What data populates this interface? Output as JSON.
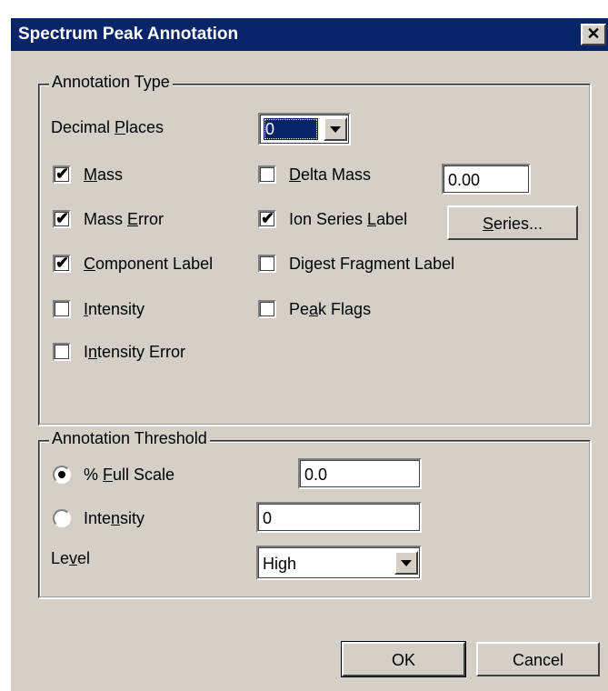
{
  "window": {
    "title": "Spectrum Peak Annotation",
    "close_glyph": "✕"
  },
  "annotation_type": {
    "legend": "Annotation Type",
    "decimal_places": {
      "label_pre": "Decimal ",
      "label_ul": "P",
      "label_post": "laces",
      "value": "0"
    },
    "mass": {
      "label_pre": "",
      "label_ul": "M",
      "label_post": "ass",
      "checked": true
    },
    "mass_error": {
      "label_pre": "Mass ",
      "label_ul": "E",
      "label_post": "rror",
      "checked": true
    },
    "component_label": {
      "label_pre": "",
      "label_ul": "C",
      "label_post": "omponent Label",
      "checked": true
    },
    "intensity": {
      "label_pre": "",
      "label_ul": "I",
      "label_post": "ntensity",
      "checked": false
    },
    "intensity_error": {
      "label_pre": "I",
      "label_ul": "n",
      "label_post": "tensity Error",
      "checked": false
    },
    "delta_mass": {
      "label_pre": "",
      "label_ul": "D",
      "label_post": "elta Mass",
      "checked": false,
      "value": "0.00"
    },
    "ion_series_label": {
      "label_pre": "Ion Series ",
      "label_ul": "L",
      "label_post": "abel",
      "checked": true
    },
    "series_button": {
      "label_pre": "",
      "label_ul": "S",
      "label_post": "eries..."
    },
    "digest_fragment_label": {
      "label_pre": "Digest Fragment Label",
      "label_ul": "",
      "label_post": "",
      "checked": false
    },
    "peak_flags": {
      "label_pre": "Pe",
      "label_ul": "a",
      "label_post": "k Flags",
      "checked": false
    }
  },
  "annotation_threshold": {
    "legend": "Annotation Threshold",
    "full_scale": {
      "label_pre": "% ",
      "label_ul": "F",
      "label_post": "ull Scale",
      "selected": true,
      "value": "0.0"
    },
    "intensity": {
      "label_pre": "Inte",
      "label_ul": "n",
      "label_post": "sity",
      "selected": false,
      "value": "0"
    },
    "level": {
      "label_pre": "Le",
      "label_ul": "v",
      "label_post": "el",
      "value": "High"
    }
  },
  "buttons": {
    "ok": "OK",
    "cancel": "Cancel"
  },
  "colors": {
    "titlebar": "#0a246a",
    "dialog_face": "#d4d0c8",
    "selection": "#0a246a"
  }
}
